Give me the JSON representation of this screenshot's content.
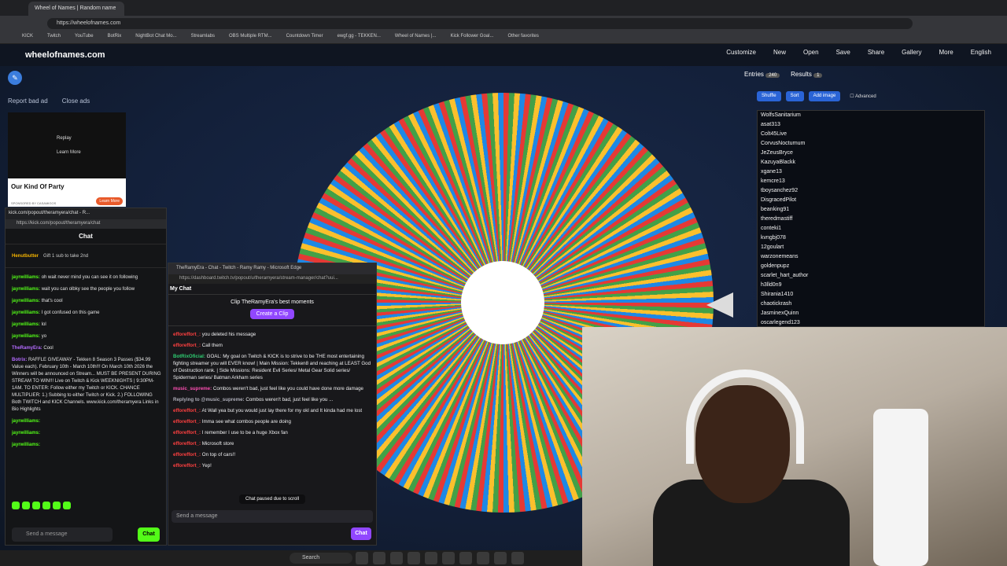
{
  "browser": {
    "tab_title": "Wheel of Names | Random name",
    "url": "https://wheelofnames.com",
    "bookmarks": [
      "KICK",
      "Twitch",
      "YouTube",
      "BotRix",
      "NightBot Chat Mo...",
      "Streamlabs",
      "OBS Multiple RTM...",
      "Countdown Timer",
      "ewgf.gg - TEKKEN...",
      "Wheel of Names |...",
      "Kick Follower Goal...",
      "Other favorites"
    ]
  },
  "site": {
    "logo": "wheelofnames.com",
    "menu": [
      "Customize",
      "New",
      "Open",
      "Save",
      "Share",
      "Gallery",
      "More",
      "English"
    ]
  },
  "ad": {
    "report": "Report bad ad",
    "close": "Close ads",
    "replay": "Replay",
    "learn": "Learn More",
    "title": "Our Kind Of Party",
    "sponsor": "SPONSORED BY CASAMIGOS",
    "button": "Learn More"
  },
  "kick": {
    "window_title": "kick.com/popout/theramyera/chat - R...",
    "url": "https://kick.com/popout/theramyera/chat",
    "header": "Chat",
    "pinned_user": "Henutbutter",
    "pinned_text": "Gift 1 sub to take 2nd",
    "messages": [
      {
        "user": "jayrwilliams:",
        "text": "oh wait never mind you can see it on following"
      },
      {
        "user": "jayrwilliams:",
        "text": "wait you can olbky see the people you follow"
      },
      {
        "user": "jayrwilliams:",
        "text": "that's cool"
      },
      {
        "user": "jayrwilliams:",
        "text": "I got confused on this game"
      },
      {
        "user": "jayrwilliams:",
        "text": "lol"
      },
      {
        "user": "jayrwilliams:",
        "text": "yo"
      },
      {
        "user": "TheRamyEra:",
        "text": "Cool"
      },
      {
        "user": "Botrix:",
        "text": "RAFFLE GIVEAWAY - Tekken 8 Season 3 Passes ($34.99 Value each). February 10th - March 10th!!! On March 10th 2026 the Winners will be announced on Stream... MUST BE PRESENT DURING STREAM TO WIN!!! Live on Twitch & Kick WEEKNIGHTS | 9:30PM-1AM. TO ENTER: Follow either my Twitch or KICK. CHANCE MULTIPLIER: 1.) Subbing to either Twitch or Kick. 2.) FOLLOWING Both TWITCH and KICK Channels. www.kick.com/theramyera Links in Bio Highlights"
      },
      {
        "user": "jayrwilliams:",
        "text": ""
      },
      {
        "user": "jayrwilliams:",
        "text": ""
      },
      {
        "user": "jayrwilliams:",
        "text": ""
      }
    ],
    "input_placeholder": "Send a message",
    "chat_button": "Chat"
  },
  "twitch": {
    "window_title": "TheRamyEra - Chat - Twitch - Ramy Ramy - Microsoft Edge",
    "url": "https://dashboard.twitch.tv/popout/u/theramyera/stream-manager/chat?uui...",
    "my_chat": "My Chat",
    "clip_title": "Clip TheRamyEra's best moments",
    "clip_button": "Create a Clip",
    "messages": [
      {
        "user": "efforeffort_:",
        "text": "you deleted his message",
        "cls": ""
      },
      {
        "user": "efforeffort_:",
        "text": "Call them",
        "cls": ""
      },
      {
        "user": "BotRixOficial:",
        "text": "GOAL: My goal on Twitch & KICK is to strive to be THE most entertaining fighting streamer you will EVER know! | Main Mission: Tekken8 and reaching at LEAST God of Destruction rank. | Side Missions: Resident Evil Series/ Metal Gear Solid series/ Spiderman series/ Batman Arkham series",
        "cls": "green"
      },
      {
        "user": "music_supreme:",
        "text": "Combos weren't bad, just feel like you could have done more damage",
        "cls": "pink"
      },
      {
        "user": "Replying to @music_supreme:",
        "text": "Combos weren't bad, just feel like you ...",
        "cls": ""
      },
      {
        "user": "efforeffort_:",
        "text": "At Wall yea but you would just lay there for my okl and It kinda had me lost",
        "cls": ""
      },
      {
        "user": "efforeffort_:",
        "text": "Imma see what combos people are doing",
        "cls": ""
      },
      {
        "user": "efforeffort_:",
        "text": "I remember I use to be a huge Xbox fan",
        "cls": ""
      },
      {
        "user": "efforeffort_:",
        "text": "Microsoft store",
        "cls": ""
      },
      {
        "user": "efforeffort_:",
        "text": "On top of cars!!",
        "cls": ""
      },
      {
        "user": "efforeffort_:",
        "text": "Yep!",
        "cls": ""
      }
    ],
    "paused": "Chat paused due to scroll",
    "input_placeholder": "Send a message",
    "chat_button": "Chat"
  },
  "panel": {
    "entries_tab": "Entries",
    "entries_count": "240",
    "results_tab": "Results",
    "results_count": "1",
    "shuffle": "Shuffle",
    "sort": "Sort",
    "add_image": "Add image",
    "advanced": "Advanced",
    "entries": [
      "WolfsSanitarium",
      "asat313",
      "Colt45Live",
      "CorvusNocturnum",
      "JeZeusBryce",
      "KazuyaBlackk",
      "xgane13",
      "kemcre13",
      "tboysanchez92",
      "DisgracedPilot",
      "beanking91",
      "theredmastiff",
      "conteki1",
      "kvngbj078",
      "12goulart",
      "warzonemeans",
      "goldenpupz",
      "scarlet_hart_author",
      "h3lld0n9",
      "Shirania1410",
      "chaotickrash",
      "JasminexQuinn",
      "oscarlegend123"
    ]
  },
  "taskbar": {
    "search": "Search"
  }
}
